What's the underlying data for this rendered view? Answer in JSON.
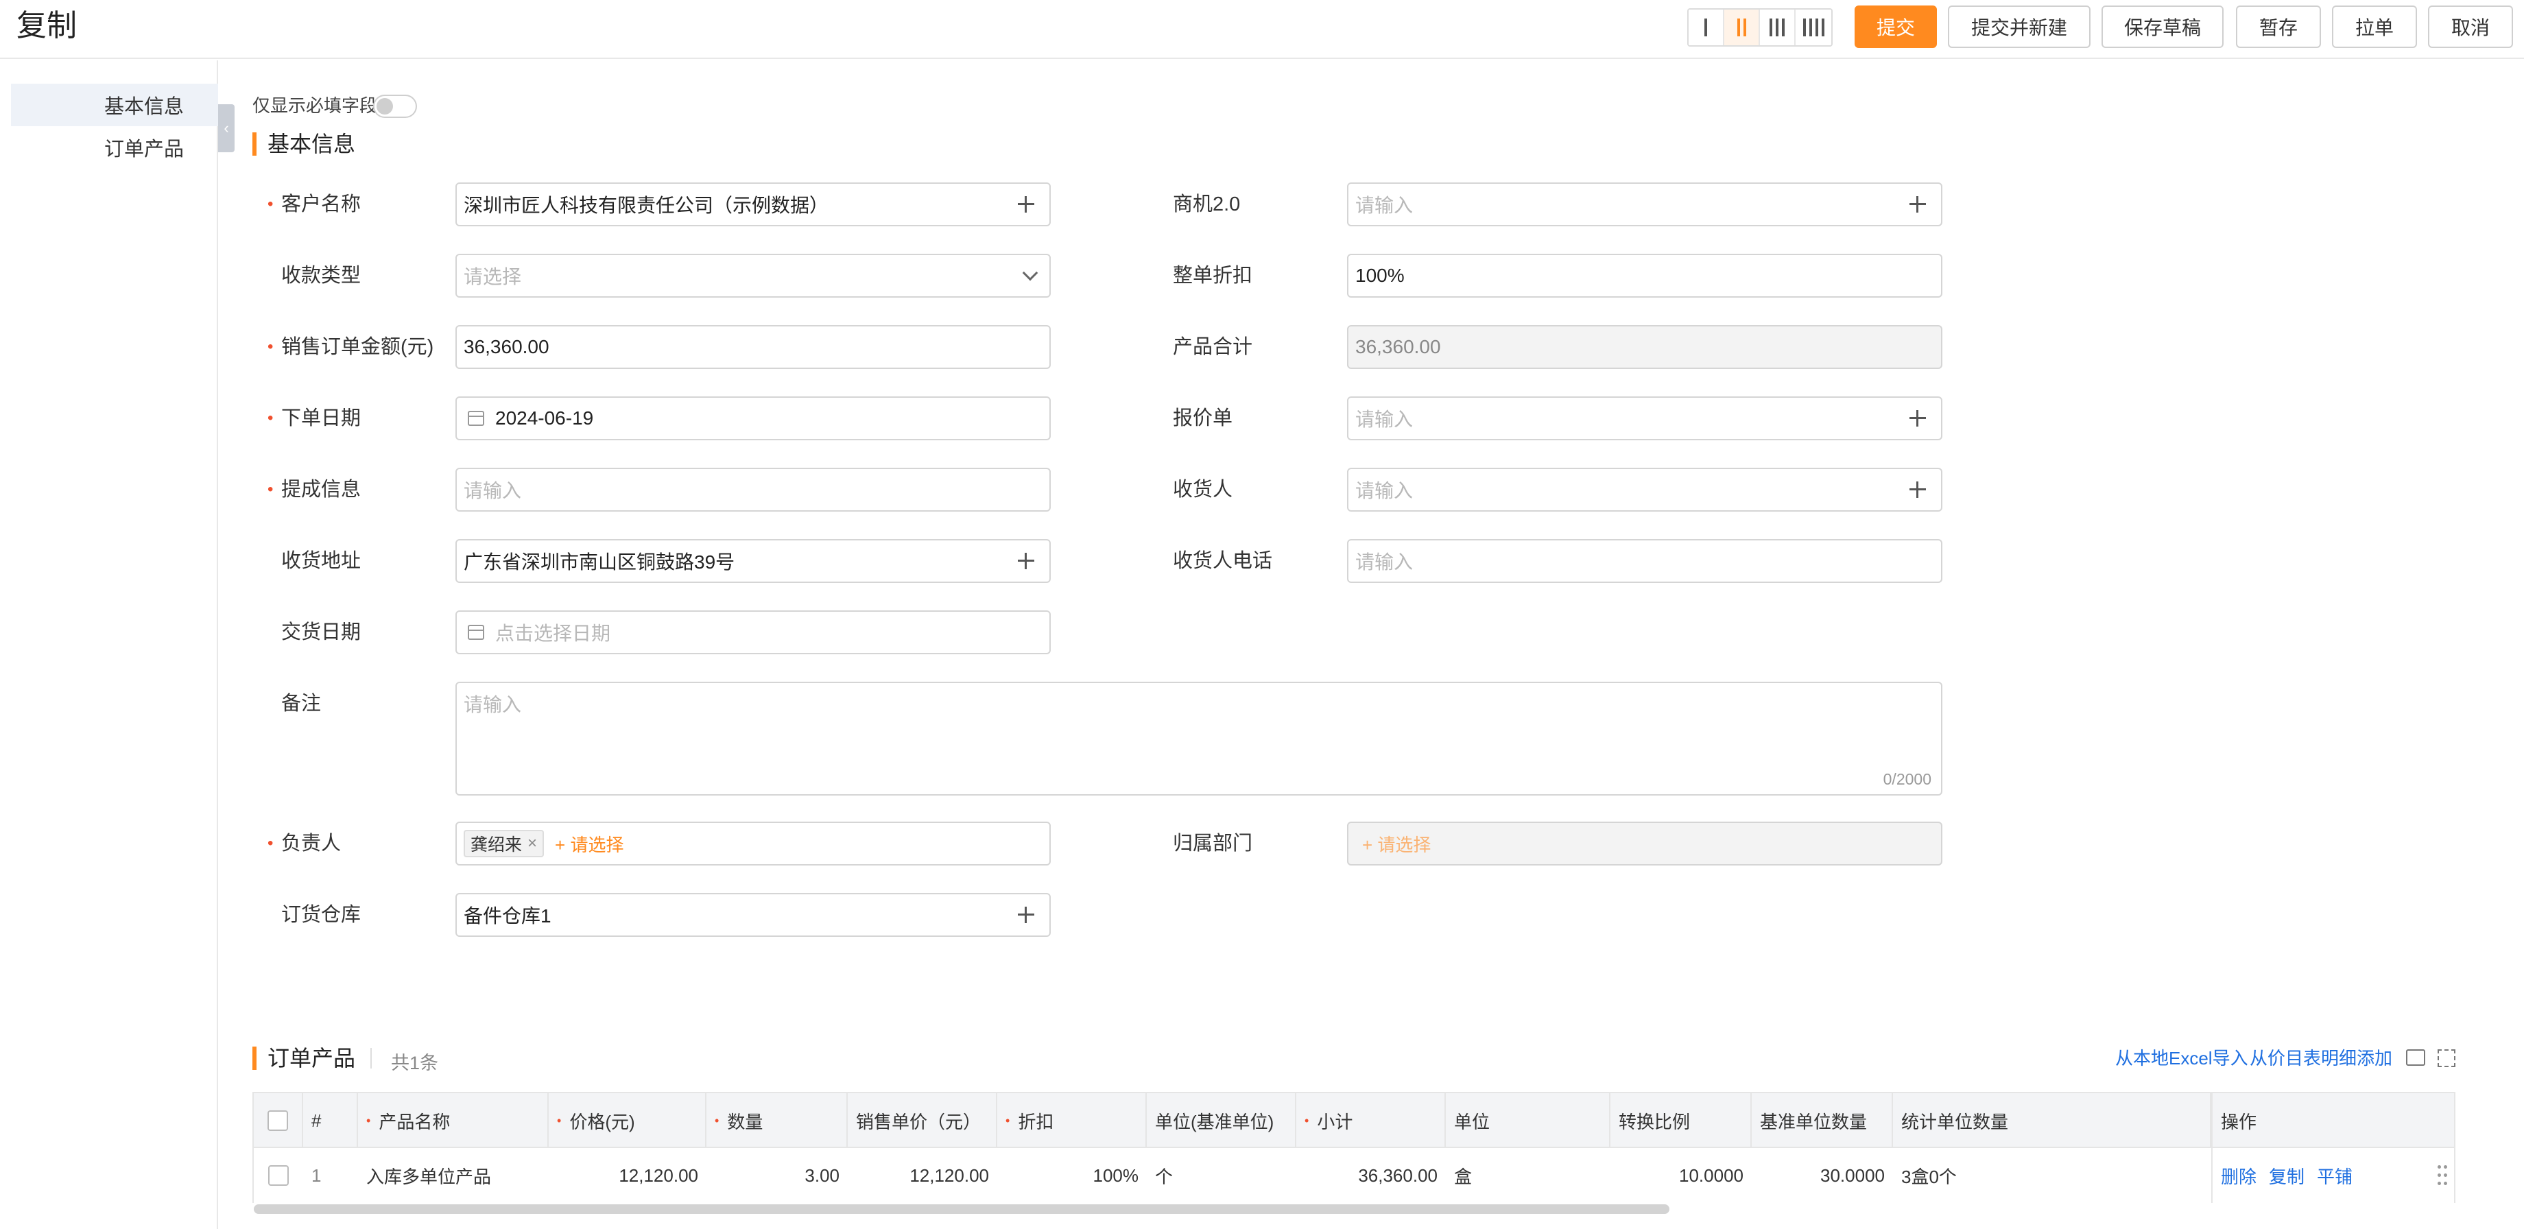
{
  "header": {
    "title": "复制",
    "buttons": {
      "submit": "提交",
      "submit_new": "提交并新建",
      "save_draft": "保存草稿",
      "temp_save": "暂存",
      "pull_order": "拉单",
      "cancel": "取消"
    }
  },
  "sidebar": {
    "items": [
      {
        "label": "基本信息",
        "active": true
      },
      {
        "label": "订单产品",
        "active": false
      }
    ]
  },
  "form": {
    "required_only_label": "仅显示必填字段",
    "section_title": "基本信息",
    "fields": {
      "customer": {
        "label": "客户名称",
        "value": "深圳市匠人科技有限责任公司（示例数据）"
      },
      "opportunity": {
        "label": "商机2.0",
        "placeholder": "请输入"
      },
      "payment_type": {
        "label": "收款类型",
        "placeholder": "请选择"
      },
      "discount": {
        "label": "整单折扣",
        "value": "100%"
      },
      "order_amount": {
        "label": "销售订单金额(元)",
        "value": "36,360.00"
      },
      "product_total": {
        "label": "产品合计",
        "value": "36,360.00"
      },
      "order_date": {
        "label": "下单日期",
        "value": "2024-06-19"
      },
      "quote": {
        "label": "报价单",
        "placeholder": "请输入"
      },
      "commission": {
        "label": "提成信息",
        "placeholder": "请输入"
      },
      "receiver": {
        "label": "收货人",
        "placeholder": "请输入"
      },
      "address": {
        "label": "收货地址",
        "value": "广东省深圳市南山区铜鼓路39号"
      },
      "receiver_phone": {
        "label": "收货人电话",
        "placeholder": "请输入"
      },
      "delivery_date": {
        "label": "交货日期",
        "placeholder": "点击选择日期"
      },
      "remark": {
        "label": "备注",
        "placeholder": "请输入",
        "counter": "0/2000"
      },
      "owner": {
        "label": "负责人",
        "tag": "龚绍来",
        "add": "+ 请选择"
      },
      "department": {
        "label": "归属部门",
        "add": "+ 请选择"
      },
      "warehouse": {
        "label": "订货仓库",
        "value": "备件仓库1"
      }
    }
  },
  "products": {
    "title": "订单产品",
    "count": "共1条",
    "links": {
      "excel": "从本地Excel导入",
      "price_list": "从价目表明细添加"
    },
    "columns": [
      "#",
      "产品名称",
      "价格(元)",
      "数量",
      "销售单价（元）",
      "折扣",
      "单位(基准单位)",
      "小计",
      "单位",
      "转换比例",
      "基准单位数量",
      "统计单位数量",
      "操作"
    ],
    "rows": [
      {
        "index": "1",
        "name": "入库多单位产品",
        "price": "12,120.00",
        "qty": "3.00",
        "unit_price": "12,120.00",
        "discount": "100%",
        "base_unit": "个",
        "subtotal": "36,360.00",
        "unit": "盒",
        "ratio": "10.0000",
        "base_qty": "30.0000",
        "stat_qty": "3盒0个",
        "ops": [
          "删除",
          "复制",
          "平铺"
        ]
      }
    ]
  }
}
